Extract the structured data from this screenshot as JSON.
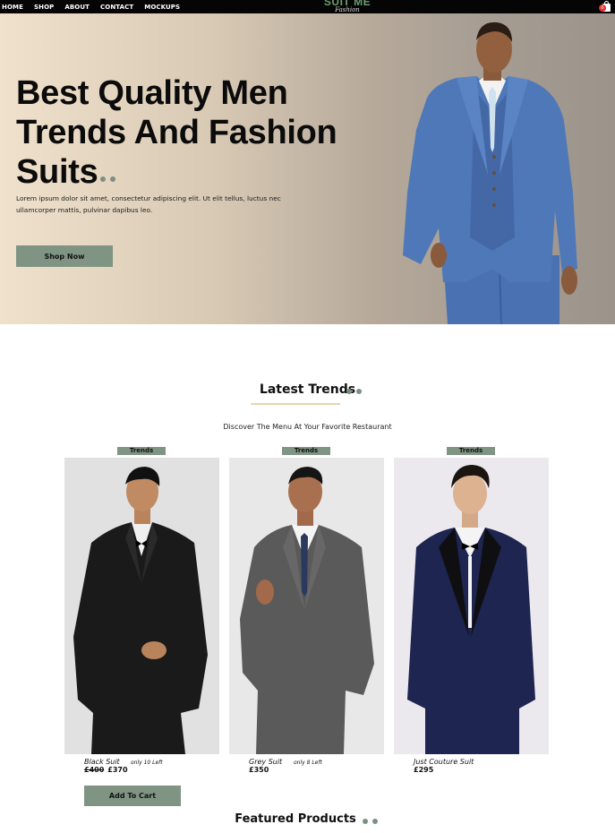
{
  "nav": {
    "links": [
      "HOME",
      "SHOP",
      "ABOUT",
      "CONTACT",
      "MOCKUPS"
    ],
    "logo_main": "SUIT ME",
    "logo_sub": "Fashion",
    "cart_count": "0"
  },
  "hero": {
    "title_line1": "Best Quality Men",
    "title_line2": "Trends And Fashion",
    "title_line3": "Suits",
    "description": "Lorem ipsum dolor sit amet, consectetur adipiscing elit. Ut elit tellus, luctus nec ullamcorper mattis, pulvinar dapibus leo.",
    "cta_label": "Shop Now"
  },
  "trends": {
    "title": "Latest Trends",
    "subtitle": "Discover The Menu At Your Favorite Restaurant",
    "products": [
      {
        "badge": "Trends",
        "name": "Black Suit",
        "stock": "only 10 Left",
        "old_price": "£400",
        "price": "£370"
      },
      {
        "badge": "Trends",
        "name": "Grey Suit",
        "stock": "only 8 Left",
        "old_price": "",
        "price": "£350"
      },
      {
        "badge": "Trends",
        "name": "Just Couture Suit",
        "stock": "",
        "old_price": "",
        "price": "£295"
      }
    ],
    "add_to_cart_label": "Add To Cart"
  },
  "featured": {
    "title": "Featured Products"
  },
  "colors": {
    "accent_green": "#7f9482",
    "nav_bg": "#050505",
    "hero_gradient_start": "#f0e1cc",
    "hero_gradient_end": "#9c948b",
    "underline": "#e6d6b0",
    "cart_badge": "#e23030"
  }
}
